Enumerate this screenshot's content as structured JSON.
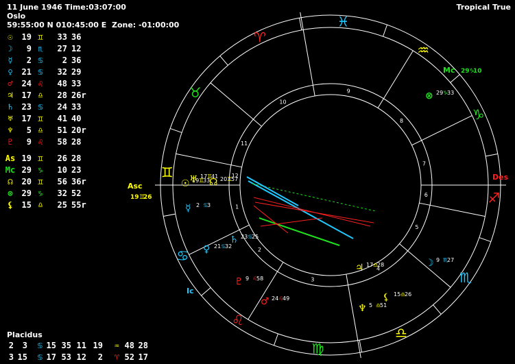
{
  "header": {
    "line1": "11 June 1946 Time:03:07:00",
    "line2": "Oslo",
    "line3": "59:55:00 N 010:45:00 E  Zone: -01:00:00",
    "mode": "Tropical True"
  },
  "colors": {
    "fire": "#ff2020",
    "earth": "#20e020",
    "air": "#ffff00",
    "water": "#20c8ff",
    "text": "#ffffff"
  },
  "planets": [
    {
      "glyph": "☉",
      "gcolor": "#ffff00",
      "deg": "19",
      "sign": "♊",
      "scolor": "#ffff00",
      "min": "33",
      "sec": "36"
    },
    {
      "glyph": "☽",
      "gcolor": "#20c8ff",
      "deg": "9",
      "sign": "♏",
      "scolor": "#20c8ff",
      "min": "27",
      "sec": "12"
    },
    {
      "glyph": "☿",
      "gcolor": "#20c8ff",
      "deg": "2",
      "sign": "♋",
      "scolor": "#20c8ff",
      "min": "2",
      "sec": "36"
    },
    {
      "glyph": "♀",
      "gcolor": "#20c8ff",
      "deg": "21",
      "sign": "♋",
      "scolor": "#20c8ff",
      "min": "32",
      "sec": "29"
    },
    {
      "glyph": "♂",
      "gcolor": "#ff2020",
      "deg": "24",
      "sign": "♌",
      "scolor": "#ff2020",
      "min": "48",
      "sec": "33"
    },
    {
      "glyph": "♃",
      "gcolor": "#ffff00",
      "deg": "17",
      "sign": "♎",
      "scolor": "#ffff00",
      "min": "28",
      "sec": "26r"
    },
    {
      "glyph": "♄",
      "gcolor": "#20c8ff",
      "deg": "23",
      "sign": "♋",
      "scolor": "#20c8ff",
      "min": "24",
      "sec": "33"
    },
    {
      "glyph": "♅",
      "gcolor": "#ffff00",
      "deg": "17",
      "sign": "♊",
      "scolor": "#ffff00",
      "min": "41",
      "sec": "40"
    },
    {
      "glyph": "♆",
      "gcolor": "#ffff00",
      "deg": "5",
      "sign": "♎",
      "scolor": "#ffff00",
      "min": "51",
      "sec": "20r"
    },
    {
      "glyph": "♇",
      "gcolor": "#ff2020",
      "deg": "9",
      "sign": "♌",
      "scolor": "#ff2020",
      "min": "58",
      "sec": "28"
    },
    {
      "glyph": "As",
      "gcolor": "#ffff00",
      "deg": "19",
      "sign": "♊",
      "scolor": "#ffff00",
      "min": "26",
      "sec": "28"
    },
    {
      "glyph": "Mc",
      "gcolor": "#20e020",
      "deg": "29",
      "sign": "♑",
      "scolor": "#20e020",
      "min": "10",
      "sec": "23"
    },
    {
      "glyph": "☊",
      "gcolor": "#ffff00",
      "deg": "20",
      "sign": "♊",
      "scolor": "#ffff00",
      "min": "56",
      "sec": "36r"
    },
    {
      "glyph": "⊗",
      "gcolor": "#20e020",
      "deg": "29",
      "sign": "♑",
      "scolor": "#20e020",
      "min": "32",
      "sec": "52"
    },
    {
      "glyph": "⚸",
      "gcolor": "#ffff00",
      "deg": "15",
      "sign": "♎",
      "scolor": "#ffff00",
      "min": "25",
      "sec": "55r"
    }
  ],
  "houses": {
    "title": "Placidus",
    "rows": [
      [
        {
          "t": "2",
          "c": "#ffffff"
        },
        {
          "t": "3",
          "c": "#ffffff"
        },
        {
          "t": "♋",
          "c": "#20c8ff"
        },
        {
          "t": "15",
          "c": "#ffffff"
        },
        {
          "t": "35",
          "c": "#ffffff"
        },
        {
          "t": "11",
          "c": "#ffffff"
        },
        {
          "t": "19",
          "c": "#ffffff"
        },
        {
          "t": "♒",
          "c": "#ffff00"
        },
        {
          "t": "48",
          "c": "#ffffff"
        },
        {
          "t": "28",
          "c": "#ffffff"
        }
      ],
      [
        {
          "t": "3",
          "c": "#ffffff"
        },
        {
          "t": "15",
          "c": "#ffffff"
        },
        {
          "t": "♋",
          "c": "#20c8ff"
        },
        {
          "t": "17",
          "c": "#ffffff"
        },
        {
          "t": "53",
          "c": "#ffffff"
        },
        {
          "t": "12",
          "c": "#ffffff"
        },
        {
          "t": "2",
          "c": "#ffffff"
        },
        {
          "t": "♈",
          "c": "#ff2020"
        },
        {
          "t": "52",
          "c": "#ffffff"
        },
        {
          "t": "17",
          "c": "#ffffff"
        }
      ]
    ]
  },
  "wheel": {
    "zodiac": [
      {
        "g": "♈",
        "c": "#ff2020",
        "a": "aries"
      },
      {
        "g": "♉",
        "c": "#20e020",
        "a": "taurus"
      },
      {
        "g": "♊",
        "c": "#ffff00",
        "a": "gemini"
      },
      {
        "g": "♋",
        "c": "#20c8ff",
        "a": "cancer"
      },
      {
        "g": "♌",
        "c": "#ff2020",
        "a": "leo"
      },
      {
        "g": "♍",
        "c": "#20e020",
        "a": "virgo"
      },
      {
        "g": "♎",
        "c": "#ffff00",
        "a": "libra"
      },
      {
        "g": "♏",
        "c": "#20c8ff",
        "a": "scorpio"
      },
      {
        "g": "♐",
        "c": "#ff2020",
        "a": "sagittarius"
      },
      {
        "g": "♑",
        "c": "#20e020",
        "a": "capricorn"
      },
      {
        "g": "♒",
        "c": "#ffff00",
        "a": "aquarius"
      },
      {
        "g": "♓",
        "c": "#20c8ff",
        "a": "pisces"
      }
    ],
    "house_numbers": [
      "1",
      "2",
      "3",
      "4",
      "5",
      "6",
      "7",
      "8",
      "9",
      "10",
      "11",
      "12"
    ],
    "angles": {
      "asc": "Asc",
      "asc_deg": "19",
      "asc_min": "26",
      "asc_sign": "♊",
      "mc": "Mc",
      "mc_deg": "29",
      "mc_min": "10",
      "mc_sign": "♑",
      "des": "Des",
      "ic": "Ic"
    },
    "planet_labels": [
      {
        "g": "☉",
        "c": "#ffff00",
        "d": "19",
        "m": "33",
        "s": "♊",
        "sc": "#ffff00"
      },
      {
        "g": "♅",
        "c": "#ffff00",
        "d": "17",
        "m": "41",
        "s": "♊",
        "sc": "#ffff00"
      },
      {
        "g": "☊",
        "c": "#ffff00",
        "d": "20",
        "m": "57",
        "s": "♊",
        "sc": "#ffff00"
      },
      {
        "g": "☿",
        "c": "#20c8ff",
        "d": "2",
        "m": "3",
        "s": "♋",
        "sc": "#20c8ff"
      },
      {
        "g": "♀",
        "c": "#20c8ff",
        "d": "21",
        "m": "32",
        "s": "♋",
        "sc": "#20c8ff"
      },
      {
        "g": "♄",
        "c": "#20c8ff",
        "d": "23",
        "m": "25",
        "s": "♋",
        "sc": "#20c8ff"
      },
      {
        "g": "♇",
        "c": "#ff2020",
        "d": "9",
        "m": "58",
        "s": "♌",
        "sc": "#ff2020"
      },
      {
        "g": "♂",
        "c": "#ff2020",
        "d": "24",
        "m": "49",
        "s": "♌",
        "sc": "#ff2020"
      },
      {
        "g": "♆",
        "c": "#ffff00",
        "d": "5",
        "m": "51",
        "s": "♎",
        "sc": "#ffff00"
      },
      {
        "g": "⚸",
        "c": "#ffff00",
        "d": "15",
        "m": "26",
        "s": "♎",
        "sc": "#ffff00"
      },
      {
        "g": "♃",
        "c": "#ffff00",
        "d": "17",
        "m": "28",
        "s": "♎",
        "sc": "#ffff00"
      },
      {
        "g": "☽",
        "c": "#20c8ff",
        "d": "9",
        "m": "27",
        "s": "♏",
        "sc": "#20c8ff"
      },
      {
        "g": "⊗",
        "c": "#20e020",
        "d": "29",
        "m": "33",
        "s": "♑",
        "sc": "#20e020"
      }
    ]
  }
}
